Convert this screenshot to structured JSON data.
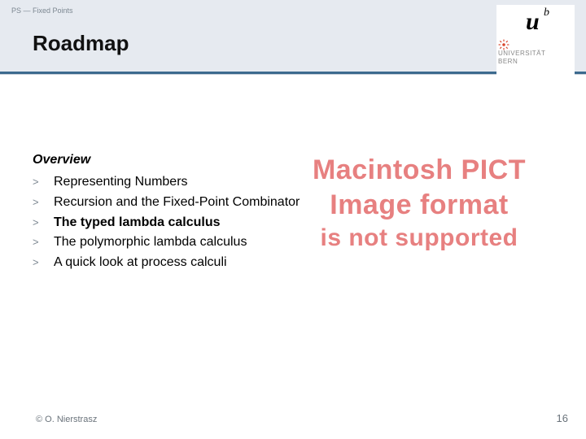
{
  "header": {
    "breadcrumb": "PS — Fixed Points",
    "title": "Roadmap"
  },
  "logo": {
    "u": "u",
    "b": "b",
    "line1": "UNIVERSITÄT",
    "line2": "BERN",
    "burst_color": "#d8452b"
  },
  "overview_label": "Overview",
  "bullet_glyph": ">",
  "items": [
    {
      "text": "Representing Numbers",
      "bold": false
    },
    {
      "text": "Recursion and the Fixed-Point Combinator",
      "bold": false
    },
    {
      "text": "The typed lambda calculus",
      "bold": true
    },
    {
      "text": "The polymorphic lambda calculus",
      "bold": false
    },
    {
      "text": "A quick look at process calculi",
      "bold": false
    }
  ],
  "watermark": {
    "line1": "Macintosh PICT",
    "line2": "Image format",
    "line3": "is not supported"
  },
  "footer": {
    "left": "© O. Nierstrasz",
    "right": "16"
  }
}
